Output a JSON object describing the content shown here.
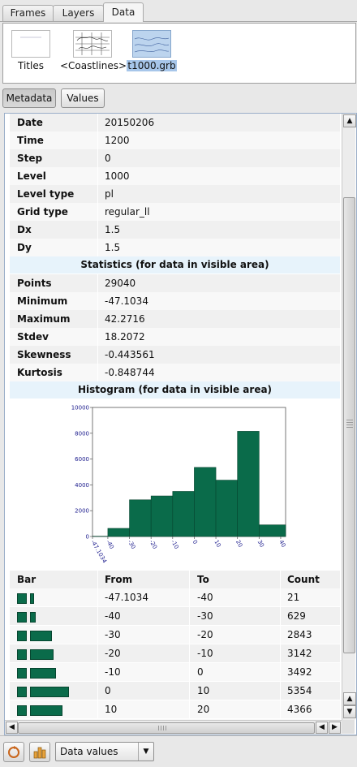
{
  "tabs": [
    {
      "label": "Frames",
      "active": false
    },
    {
      "label": "Layers",
      "active": false
    },
    {
      "label": "Data",
      "active": true
    }
  ],
  "layers": [
    {
      "label": "Titles",
      "icon": "titles-thumbnail-icon",
      "selected": false
    },
    {
      "label": "<Coastlines>",
      "icon": "coastlines-thumbnail-icon",
      "selected": false
    },
    {
      "label": "t1000.grb",
      "icon": "grib-field-thumbnail-icon",
      "selected": true
    }
  ],
  "view_buttons": {
    "metadata": "Metadata",
    "values": "Values"
  },
  "metadata": [
    {
      "key": "Date",
      "value": "20150206"
    },
    {
      "key": "Time",
      "value": "1200"
    },
    {
      "key": "Step",
      "value": "0"
    },
    {
      "key": "Level",
      "value": "1000"
    },
    {
      "key": "Level type",
      "value": "pl"
    },
    {
      "key": "Grid type",
      "value": "regular_ll"
    },
    {
      "key": "Dx",
      "value": "1.5"
    },
    {
      "key": "Dy",
      "value": "1.5"
    }
  ],
  "statistics": {
    "title": "Statistics (for data in visible area)",
    "rows": [
      {
        "key": "Points",
        "value": "29040"
      },
      {
        "key": "Minimum",
        "value": "-47.1034"
      },
      {
        "key": "Maximum",
        "value": "42.2716"
      },
      {
        "key": "Stdev",
        "value": "18.2072"
      },
      {
        "key": "Skewness",
        "value": "-0.443561"
      },
      {
        "key": "Kurtosis",
        "value": "-0.848744"
      }
    ]
  },
  "histogram_title": "Histogram (for data in visible area)",
  "chart_data": {
    "type": "bar",
    "title": "",
    "xlabel": "",
    "ylabel": "",
    "bins": [
      {
        "from": -47.1034,
        "to": -40,
        "count": 21
      },
      {
        "from": -40,
        "to": -30,
        "count": 629
      },
      {
        "from": -30,
        "to": -20,
        "count": 2843
      },
      {
        "from": -20,
        "to": -10,
        "count": 3142
      },
      {
        "from": -10,
        "to": 0,
        "count": 3492
      },
      {
        "from": 0,
        "to": 10,
        "count": 5354
      },
      {
        "from": 10,
        "to": 20,
        "count": 4366
      },
      {
        "from": 20,
        "to": 30,
        "count": 8150
      },
      {
        "from": 30,
        "to": 42.2716,
        "count": 900
      }
    ],
    "xlim": [
      -47.1034,
      42.2716
    ],
    "ylim": [
      0,
      10000
    ],
    "x_tick_labels": [
      "-47.1034",
      "-40",
      "-30",
      "-20",
      "-10",
      "0",
      "10",
      "20",
      "30",
      "40"
    ],
    "y_tick_labels": [
      "0",
      "2000",
      "4000",
      "6000",
      "8000",
      "10000"
    ],
    "bar_color": "#0a6b4a",
    "grid": false
  },
  "bin_table": {
    "headers": [
      "Bar",
      "From",
      "To",
      "Count"
    ],
    "rows": [
      {
        "from": "-47.1034",
        "to": "-40",
        "count": "21",
        "rel": 0.0026
      },
      {
        "from": "-40",
        "to": "-30",
        "count": "629",
        "rel": 0.077
      },
      {
        "from": "-30",
        "to": "-20",
        "count": "2843",
        "rel": 0.35
      },
      {
        "from": "-20",
        "to": "-10",
        "count": "3142",
        "rel": 0.39
      },
      {
        "from": "-10",
        "to": "0",
        "count": "3492",
        "rel": 0.43
      },
      {
        "from": "0",
        "to": "10",
        "count": "5354",
        "rel": 0.66
      },
      {
        "from": "10",
        "to": "20",
        "count": "4366",
        "rel": 0.54
      }
    ]
  },
  "bottom": {
    "combo_value": "Data values"
  }
}
